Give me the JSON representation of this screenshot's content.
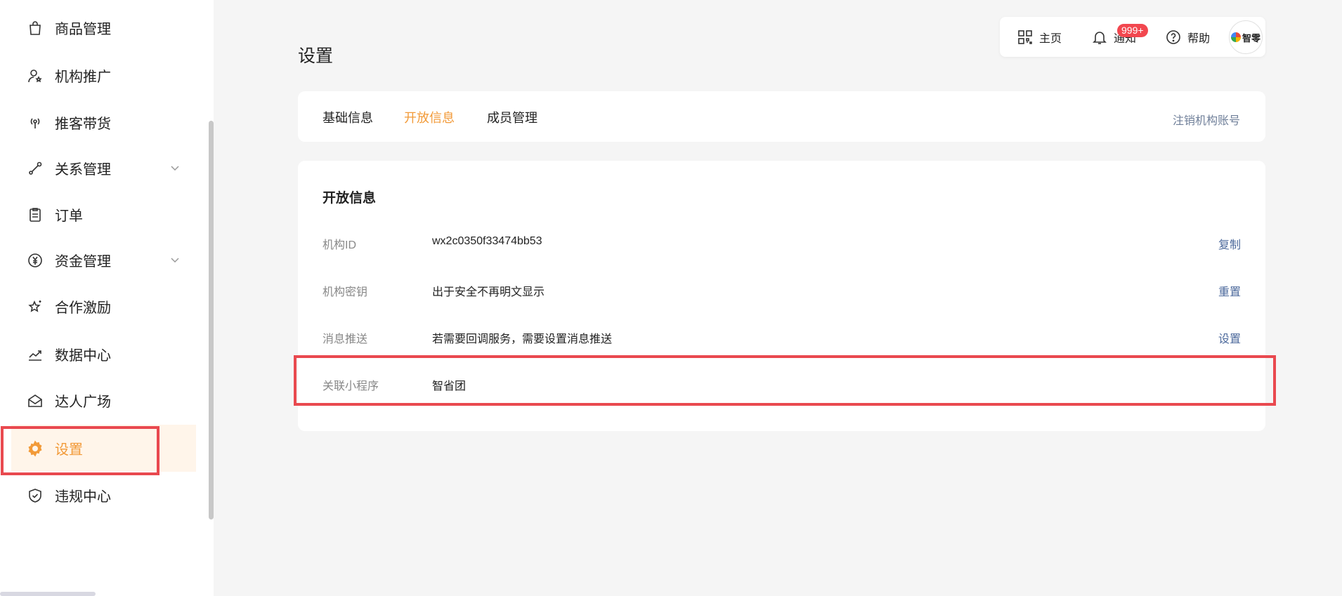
{
  "sidebar": {
    "items": [
      {
        "label": "商品管理",
        "icon": "shopping-bag-icon"
      },
      {
        "label": "机构推广",
        "icon": "user-star-icon"
      },
      {
        "label": "推客带货",
        "icon": "broadcast-icon"
      },
      {
        "label": "关系管理",
        "icon": "relation-icon",
        "expandable": true
      },
      {
        "label": "订单",
        "icon": "clipboard-icon"
      },
      {
        "label": "资金管理",
        "icon": "yen-coin-icon",
        "expandable": true
      },
      {
        "label": "合作激励",
        "icon": "star-sparkle-icon"
      },
      {
        "label": "数据中心",
        "icon": "trend-chart-icon"
      },
      {
        "label": "达人广场",
        "icon": "mail-open-icon"
      },
      {
        "label": "设置",
        "icon": "gear-icon",
        "active": true
      },
      {
        "label": "违规中心",
        "icon": "shield-check-icon"
      }
    ]
  },
  "header": {
    "page_title": "设置",
    "home_label": "主页",
    "notify_label": "通知",
    "notify_badge": "999+",
    "help_label": "帮助",
    "avatar_text": "智零"
  },
  "tabs": {
    "items": [
      "基础信息",
      "开放信息",
      "成员管理"
    ],
    "active_index": 1,
    "deregister_label": "注销机构账号"
  },
  "open_info": {
    "title": "开放信息",
    "rows": [
      {
        "label": "机构ID",
        "value": "wx2c0350f33474bb53",
        "action": "复制"
      },
      {
        "label": "机构密钥",
        "value": "出于安全不再明文显示",
        "action": "重置"
      },
      {
        "label": "消息推送",
        "value": "若需要回调服务，需要设置消息推送",
        "action": "设置"
      },
      {
        "label": "关联小程序",
        "value": "智省团",
        "action": ""
      }
    ]
  },
  "colors": {
    "accent": "#f29a38",
    "link": "#4d6a9c",
    "highlight": "#e9494f",
    "badge": "#f2474f"
  }
}
